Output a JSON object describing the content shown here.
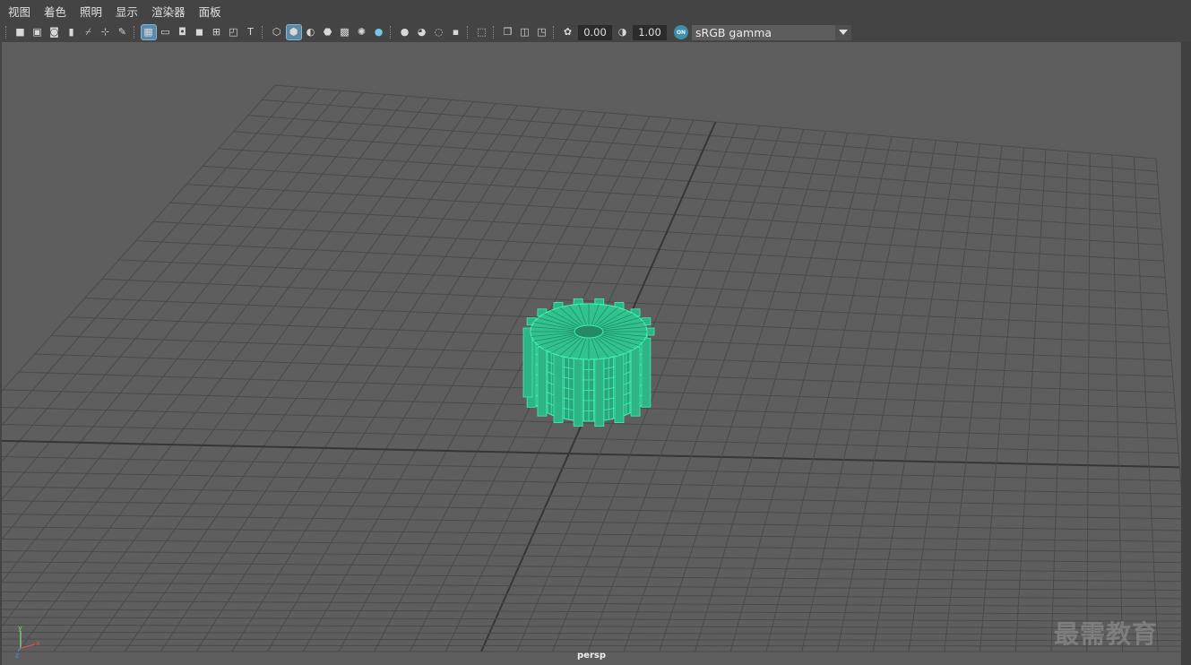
{
  "menu": [
    "视图",
    "着色",
    "照明",
    "显示",
    "渲染器",
    "面板"
  ],
  "toolbar": {
    "field_a": "0.00",
    "field_b": "1.00",
    "colorspace_badge": "ON",
    "colorspace": "sRGB gamma",
    "icons": [
      "camera-icon",
      "camera-lock-icon",
      "camera-attributes-icon",
      "bookmark-icon",
      "image-plane-icon",
      "pivot-icon",
      "grease-pencil-icon",
      "grid-icon",
      "film-gate-icon",
      "resolution-gate-icon",
      "gate-mask-icon",
      "field-chart-icon",
      "safe-action-icon",
      "safe-title-icon",
      "wireframe-icon",
      "smooth-shade-icon",
      "default-material-icon",
      "wireframe-on-shaded-icon",
      "textured-icon",
      "lights-icon",
      "shadows-icon",
      "screen-space-ao-icon",
      "motion-blur-icon",
      "multisample-aa-icon",
      "depth-of-field-icon",
      "select-camera-icon",
      "isolate-select-icon",
      "xray-icon",
      "xray-joints-icon",
      "exposure-icon",
      "gamma-icon"
    ]
  },
  "viewport": {
    "camera": "persp",
    "axis_y": "y",
    "axis_x": "x",
    "axis_z": "z"
  },
  "watermark": "最需教育",
  "colors": {
    "ui_bg": "#444444",
    "viewport_bg": "#5e5e5e",
    "grid": "#4a4a4a",
    "grid_axis": "#363636",
    "wire": "#3ff2b2",
    "highlight": "#5a8aa8"
  }
}
